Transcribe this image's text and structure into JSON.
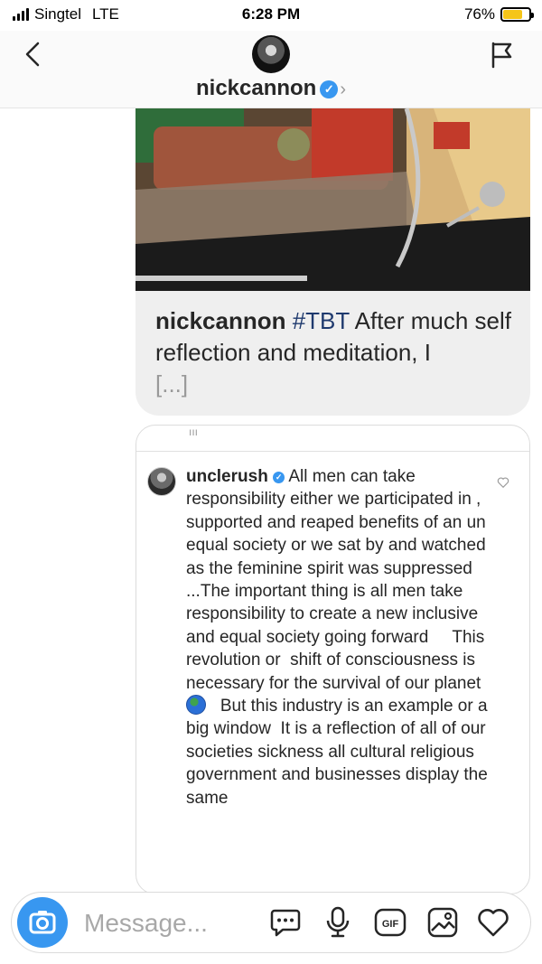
{
  "status_bar": {
    "carrier": "Singtel",
    "network": "LTE",
    "time": "6:28 PM",
    "battery_percent": "76%",
    "battery_level": 0.76,
    "battery_color": "#f5c518"
  },
  "header": {
    "username": "nickcannon",
    "verified": true,
    "back_icon": "chevron-left-icon",
    "report_icon": "flag-icon"
  },
  "shared_post": {
    "caption_user": "nickcannon",
    "caption_tag": "#TBT",
    "caption_text": "After much self reflection and meditation, I",
    "caption_more": "[...]"
  },
  "comment": {
    "user": "unclerush",
    "verified": true,
    "text_1": "All men can take responsibility either we participated in , supported and reaped benefits of an un equal society or we sat by and watched as the feminine spirit was suppressed    ...The important thing is all men take responsibility to create a new inclusive and equal society going forward     This revolution or  shift of consciousness is necessary for the survival of our planet ",
    "emoji": "globe-icon",
    "text_2": "   But this industry is an example or a big window  It is a reflection of all of our societies sickness all cultural religious government and businesses display the same"
  },
  "composer": {
    "placeholder": "Message...",
    "icons": [
      "camera-icon",
      "chat-bubble-icon",
      "microphone-icon",
      "gif-icon",
      "gallery-icon",
      "heart-icon"
    ],
    "accent": "#3897f0"
  }
}
